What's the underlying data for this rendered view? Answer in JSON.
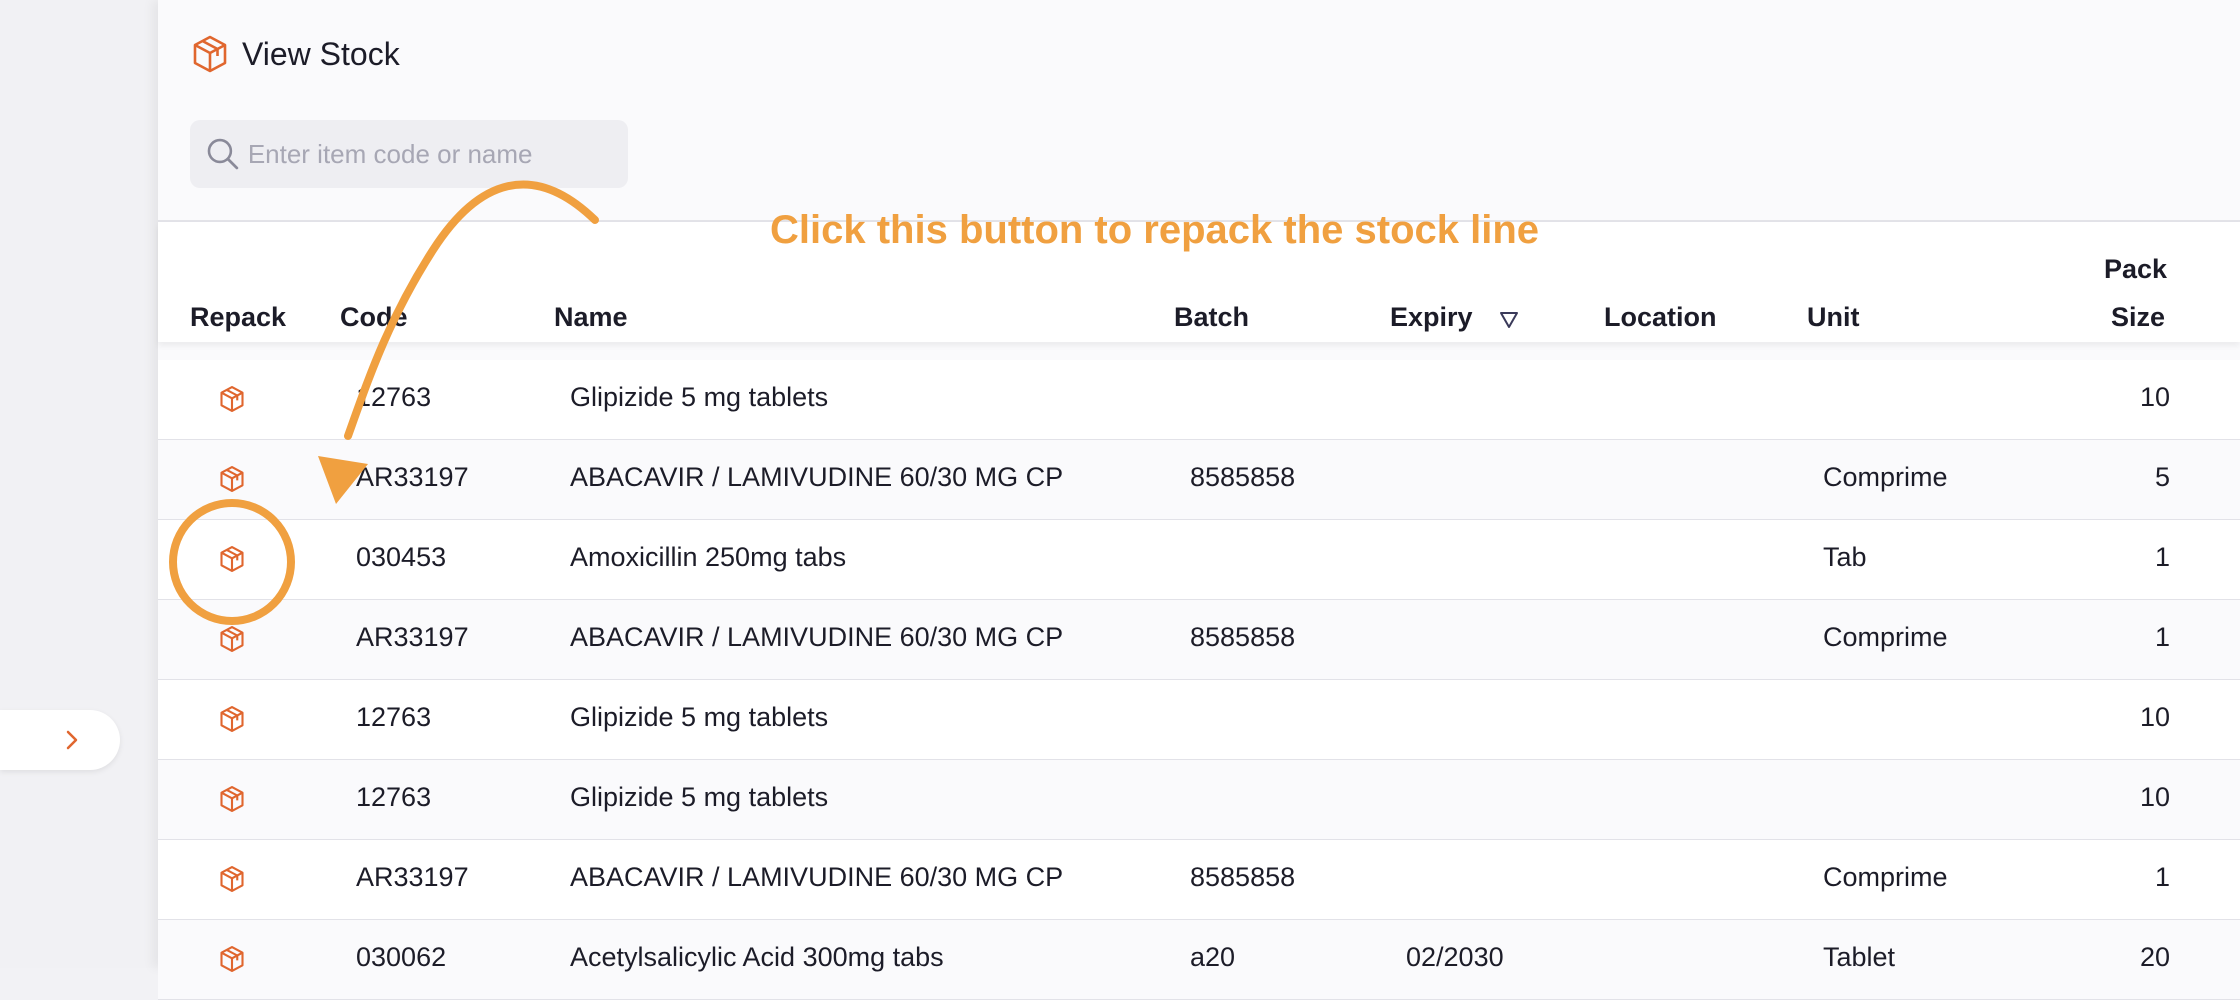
{
  "page": {
    "title": "View Stock"
  },
  "search": {
    "placeholder": "Enter item code or name",
    "value": ""
  },
  "table": {
    "headers": {
      "repack": "Repack",
      "code": "Code",
      "name": "Name",
      "batch": "Batch",
      "expiry": "Expiry",
      "location": "Location",
      "unit": "Unit",
      "pack_size_line1": "Pack",
      "pack_size_line2": "Size"
    },
    "sort": {
      "column": "expiry",
      "direction": "descending"
    },
    "rows": [
      {
        "code": "12763",
        "name": "Glipizide 5 mg tablets",
        "batch": "",
        "expiry": "",
        "location": "",
        "unit": "",
        "pack_size": "10"
      },
      {
        "code": "AR33197",
        "name": "ABACAVIR / LAMIVUDINE 60/30 MG CP",
        "batch": "8585858",
        "expiry": "",
        "location": "",
        "unit": "Comprime",
        "pack_size": "5"
      },
      {
        "code": "030453",
        "name": "Amoxicillin 250mg tabs",
        "batch": "",
        "expiry": "",
        "location": "",
        "unit": "Tab",
        "pack_size": "1"
      },
      {
        "code": "AR33197",
        "name": "ABACAVIR / LAMIVUDINE 60/30 MG CP",
        "batch": "8585858",
        "expiry": "",
        "location": "",
        "unit": "Comprime",
        "pack_size": "1"
      },
      {
        "code": "12763",
        "name": "Glipizide 5 mg tablets",
        "batch": "",
        "expiry": "",
        "location": "",
        "unit": "",
        "pack_size": "10"
      },
      {
        "code": "12763",
        "name": "Glipizide 5 mg tablets",
        "batch": "",
        "expiry": "",
        "location": "",
        "unit": "",
        "pack_size": "10"
      },
      {
        "code": "AR33197",
        "name": "ABACAVIR / LAMIVUDINE 60/30 MG CP",
        "batch": "8585858",
        "expiry": "",
        "location": "",
        "unit": "Comprime",
        "pack_size": "1"
      },
      {
        "code": "030062",
        "name": "Acetylsalicylic Acid 300mg tabs",
        "batch": "a20",
        "expiry": "02/2030",
        "location": "",
        "unit": "Tablet",
        "pack_size": "20"
      }
    ]
  },
  "annotation": {
    "text": "Click this button to repack the stock line",
    "color": "#f0a040"
  },
  "colors": {
    "accent": "#e0662e",
    "annotation": "#f0a040"
  },
  "icons": {
    "page": "package-icon",
    "search": "search-icon",
    "repack": "package-icon",
    "sort": "sort-descending-icon",
    "sidebar_toggle": "chevron-right-icon"
  }
}
